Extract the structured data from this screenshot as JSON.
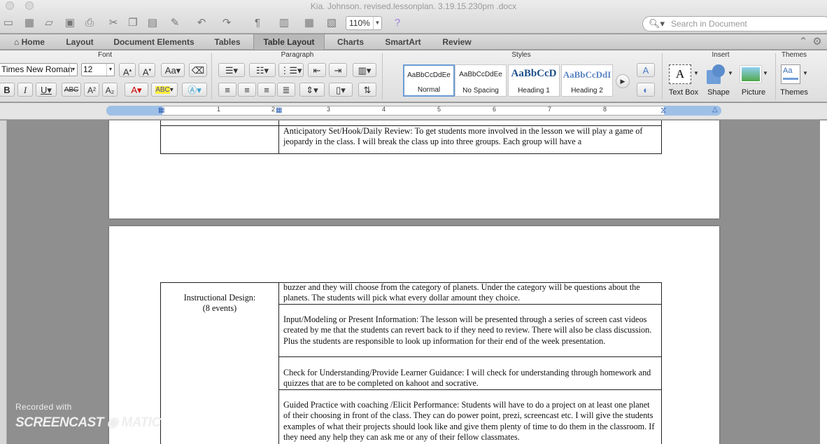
{
  "window": {
    "title": "Kia. Johnson. revised.lessonplan. 3.19.15.230pm .docx",
    "zoom": "110%",
    "search_placeholder": "Search in Document"
  },
  "ribbon_tabs": [
    {
      "label": "Home"
    },
    {
      "label": "Layout"
    },
    {
      "label": "Document Elements"
    },
    {
      "label": "Tables"
    },
    {
      "label": "Table Layout"
    },
    {
      "label": "Charts"
    },
    {
      "label": "SmartArt"
    },
    {
      "label": "Review"
    }
  ],
  "ribbon": {
    "groups": {
      "font": "Font",
      "paragraph": "Paragraph",
      "styles": "Styles",
      "insert": "Insert",
      "themes": "Themes"
    },
    "font_name": "Times New Roman",
    "font_size": "12",
    "styles": [
      {
        "sample": "AaBbCcDdEe",
        "name": "Normal"
      },
      {
        "sample": "AaBbCcDdEe",
        "name": "No Spacing"
      },
      {
        "sample": "AaBbCcD",
        "name": "Heading 1"
      },
      {
        "sample": "AaBbCcDdI",
        "name": "Heading 2"
      }
    ],
    "insert": {
      "text_box": "Text Box",
      "shape": "Shape",
      "picture": "Picture",
      "themes": "Themes"
    }
  },
  "ruler_marks": [
    "1",
    "2",
    "3",
    "4",
    "5",
    "6",
    "7",
    "8"
  ],
  "document": {
    "page1": {
      "anticipatory": "Anticipatory Set/Hook/Daily Review: To get students more involved in the lesson we will play a game of jeopardy in the class. I will break the class up into three groups. Each group will have a"
    },
    "page2": {
      "left_label_line1": "Instructional Design:",
      "left_label_line2": "(8 events)",
      "row1": "buzzer and they will choose from the category of planets. Under the category will be questions about the planets. The students will pick what every dollar amount they choice.",
      "row2": "Input/Modeling or Present Information: The lesson will be presented through a series of screen cast videos created by me that the students can revert back to if they need to review.  There will also be class discussion. Plus the students are responsible to look up information for their end of the week presentation.",
      "row3": "Check for Understanding/Provide Learner Guidance: I will check for understanding through homework and quizzes that are to be completed on kahoot and socrative.",
      "row4": "Guided Practice with coaching /Elicit Performance: Students will have to do a project on at least one planet of their choosing in front of the class. They can do power point, prezi, screencast etc. I will give the students examples of what their projects should look like and give them plenty of time to do them in the classroom. If they need any help they can ask me or any of their fellow classmates."
    }
  },
  "watermark": {
    "recorded_with": "Recorded with",
    "brand": "SCREENCAST ◉ MATIC"
  }
}
